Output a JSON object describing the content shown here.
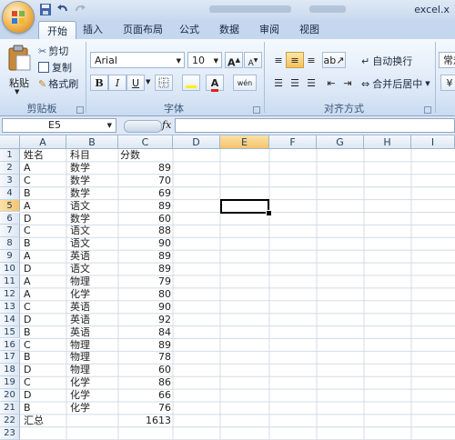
{
  "window": {
    "title": "excel.x",
    "tabs": [
      "开始",
      "插入",
      "页面布局",
      "公式",
      "数据",
      "审阅",
      "视图"
    ]
  },
  "ribbon": {
    "clipboard": {
      "paste": "粘贴",
      "cut": "剪切",
      "copy": "复制",
      "format_painter": "格式刷",
      "label": "剪贴板"
    },
    "font": {
      "name": "Arial",
      "size": "10",
      "bold": "B",
      "italic": "I",
      "underline": "U",
      "grow": "A",
      "shrink": "A",
      "font_color": "A",
      "phonetic": "wén",
      "label": "字体"
    },
    "alignment": {
      "wrap_text": "自动换行",
      "merge_center": "合并后居中",
      "label": "对齐方式"
    },
    "number": {
      "format": "常规"
    }
  },
  "formula_bar": {
    "name_box": "E5",
    "fx": "fx",
    "content": ""
  },
  "sheet": {
    "columns": [
      "A",
      "B",
      "C",
      "D",
      "E",
      "F",
      "G",
      "H",
      "I"
    ],
    "selected_column": "E",
    "selected_row": 5,
    "rows": [
      {
        "n": "1",
        "a": "姓名",
        "b": "科目",
        "c": "分数"
      },
      {
        "n": "2",
        "a": "A",
        "b": "数学",
        "c": "89"
      },
      {
        "n": "3",
        "a": "C",
        "b": "数学",
        "c": "70"
      },
      {
        "n": "4",
        "a": "B",
        "b": "数学",
        "c": "69"
      },
      {
        "n": "5",
        "a": "A",
        "b": "语文",
        "c": "89"
      },
      {
        "n": "6",
        "a": "D",
        "b": "数学",
        "c": "60"
      },
      {
        "n": "7",
        "a": "C",
        "b": "语文",
        "c": "88"
      },
      {
        "n": "8",
        "a": "B",
        "b": "语文",
        "c": "90"
      },
      {
        "n": "9",
        "a": "A",
        "b": "英语",
        "c": "89"
      },
      {
        "n": "10",
        "a": "D",
        "b": "语文",
        "c": "89"
      },
      {
        "n": "11",
        "a": "A",
        "b": "物理",
        "c": "79"
      },
      {
        "n": "12",
        "a": "A",
        "b": "化学",
        "c": "80"
      },
      {
        "n": "13",
        "a": "C",
        "b": "英语",
        "c": "90"
      },
      {
        "n": "14",
        "a": "D",
        "b": "英语",
        "c": "92"
      },
      {
        "n": "15",
        "a": "B",
        "b": "英语",
        "c": "84"
      },
      {
        "n": "16",
        "a": "C",
        "b": "物理",
        "c": "89"
      },
      {
        "n": "17",
        "a": "B",
        "b": "物理",
        "c": "78"
      },
      {
        "n": "18",
        "a": "D",
        "b": "物理",
        "c": "60"
      },
      {
        "n": "19",
        "a": "C",
        "b": "化学",
        "c": "86"
      },
      {
        "n": "20",
        "a": "D",
        "b": "化学",
        "c": "66"
      },
      {
        "n": "21",
        "a": "B",
        "b": "化学",
        "c": "76"
      },
      {
        "n": "22",
        "a": "汇总",
        "b": "",
        "c": "1613"
      },
      {
        "n": "23",
        "a": "",
        "b": "",
        "c": ""
      }
    ]
  }
}
